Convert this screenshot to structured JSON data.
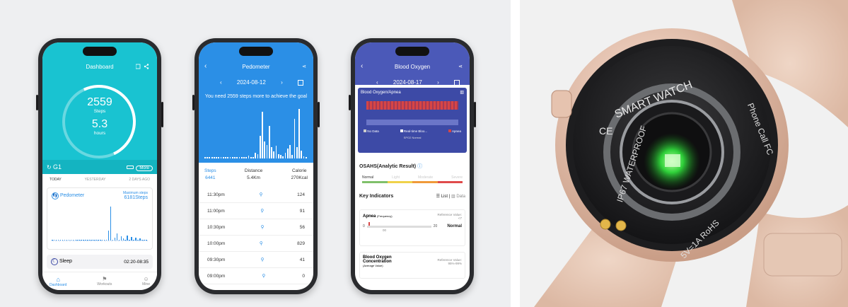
{
  "phone1": {
    "header_title": "Dashboard",
    "steps_value": "2559",
    "steps_label": "Steps",
    "hours_value": "5.3",
    "hours_label": "hours",
    "device_name": "G1",
    "more_label": "More",
    "days": [
      "TODAY",
      "YESTERDAY",
      "2 DAYS AGO"
    ],
    "pedometer_label": "Pedometer",
    "max_steps_label": "Maximum steps",
    "max_steps_value": "6181Steps",
    "sleep_label": "Sleep",
    "sleep_time": "02:20-08:35",
    "tabs": [
      "Dashboard",
      "Workouts",
      "Mine"
    ],
    "bars": [
      0,
      0,
      1,
      0,
      0,
      0,
      1,
      0,
      0,
      0,
      0,
      0,
      0,
      0,
      0,
      0,
      0,
      0,
      0,
      1,
      0,
      0,
      0,
      0,
      0,
      0,
      0,
      30,
      100,
      0,
      8,
      20,
      0,
      12,
      6,
      0,
      14,
      0,
      10,
      0,
      8,
      0,
      6,
      0,
      0,
      0
    ]
  },
  "phone2": {
    "header_title": "Pedometer",
    "date": "2024-08-12",
    "message": "You need 2559 steps more to achieve the goal",
    "stats": [
      {
        "label": "Steps",
        "value": "6441"
      },
      {
        "label": "Distance",
        "value": "5.4Km"
      },
      {
        "label": "Calorie",
        "value": "270Kcal"
      }
    ],
    "rows": [
      {
        "time": "11:30pm",
        "value": "124"
      },
      {
        "time": "11:00pm",
        "value": "91"
      },
      {
        "time": "10:30pm",
        "value": "56"
      },
      {
        "time": "10:00pm",
        "value": "829"
      },
      {
        "time": "09:30pm",
        "value": "41"
      },
      {
        "time": "09:00pm",
        "value": "0"
      }
    ],
    "bars": [
      2,
      2,
      2,
      3,
      2,
      2,
      2,
      2,
      2,
      3,
      2,
      2,
      3,
      2,
      2,
      2,
      3,
      2,
      2,
      5,
      3,
      2,
      10,
      8,
      40,
      82,
      30,
      24,
      58,
      20,
      12,
      22,
      8,
      6,
      4,
      10,
      18,
      24,
      6,
      70,
      20,
      88,
      14,
      4,
      2
    ]
  },
  "phone3": {
    "header_title": "Blood Oxygen",
    "date": "2024-08-17",
    "chart_title": "Blood Oxygen/Apnea",
    "legend": [
      "No Data",
      "Real-time Bloo...",
      "Apnea"
    ],
    "chart_footnote": "SPO2 Normal",
    "osahs_title": "OSAHS(Analytic Result)",
    "severity": [
      "Normal",
      "Light",
      "Moderate",
      "Severe"
    ],
    "key_indicators": "Key Indicators",
    "list_label": "List",
    "data_label": "Data",
    "apnea_label": "Apnea",
    "apnea_sub": "(Frequency)",
    "apnea_ref": "Reference Value:",
    "apnea_ref_val": "<7",
    "apnea_scale_min": "0",
    "apnea_scale_mid": "20",
    "apnea_scale_low": "00",
    "apnea_result": "Normal",
    "bo_label": "Blood Oxygen Concentration",
    "bo_sub": "(Average Value)",
    "bo_ref": "Reference Value:",
    "bo_ref_val": "95%-99%"
  },
  "watch": {
    "brand": "SMART WATCH",
    "left_text": "IP67 WATERPROOF",
    "right_text": "Phone Call",
    "fc": "FC",
    "bottom_text": "5V=1A RoHS",
    "ce": "CE"
  },
  "colors": {
    "cyan": "#19c3d1",
    "blue": "#2b8fe6",
    "indigo": "#4b59b8",
    "watch_pink": "#e9c9b6"
  }
}
